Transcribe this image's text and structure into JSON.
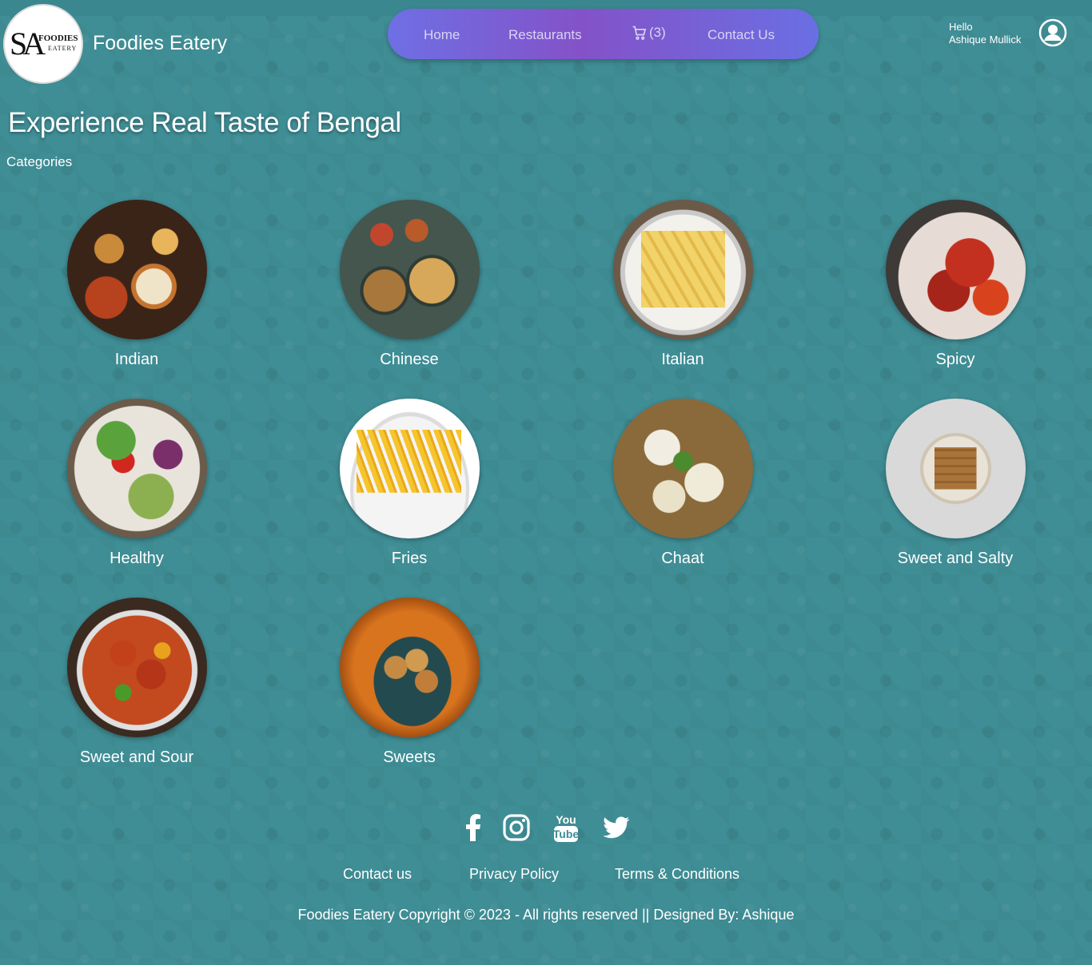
{
  "brand": {
    "name": "Foodies Eatery",
    "logo_monogram": "SA",
    "logo_text_top": "FOODIES",
    "logo_text_bottom": "EATERY"
  },
  "nav": {
    "home": "Home",
    "restaurants": "Restaurants",
    "cart_count": "(3)",
    "cart_icon": "cart-icon",
    "contact": "Contact Us"
  },
  "user": {
    "greeting": "Hello",
    "name": "Ashique Mullick",
    "icon": "user-circle-icon"
  },
  "hero": {
    "title": "Experience Real Taste of Bengal",
    "subtitle": "Categories"
  },
  "categories": [
    {
      "label": "Indian"
    },
    {
      "label": "Chinese"
    },
    {
      "label": "Italian"
    },
    {
      "label": "Spicy"
    },
    {
      "label": "Healthy"
    },
    {
      "label": "Fries"
    },
    {
      "label": "Chaat"
    },
    {
      "label": "Sweet and Salty"
    },
    {
      "label": "Sweet and Sour"
    },
    {
      "label": "Sweets"
    }
  ],
  "social": [
    "facebook-icon",
    "instagram-icon",
    "youtube-icon",
    "twitter-icon"
  ],
  "social_text": {
    "youtube_top": "You",
    "youtube_bottom": "Tube"
  },
  "footer": {
    "links": [
      "Contact us",
      "Privacy Policy",
      "Terms & Conditions"
    ],
    "copyright": "Foodies Eatery Copyright © 2023 - All rights reserved || Designed By: Ashique"
  },
  "colors": {
    "background": "#3f8d95",
    "nav_gradient_start": "#6f6fe4",
    "nav_gradient_mid": "#8452c8"
  }
}
